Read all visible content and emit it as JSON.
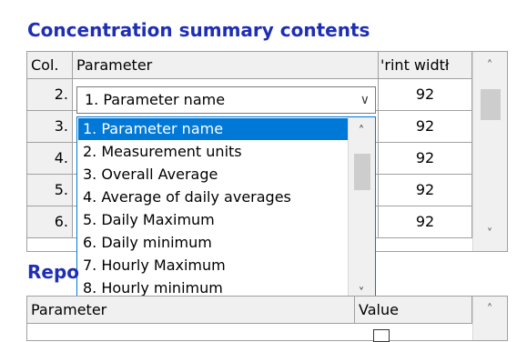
{
  "summary_heading": "Concentration summary contents",
  "grid": {
    "col_header": "Col.",
    "param_header": "Parameter",
    "width_header": "'rint widtł",
    "rows": [
      {
        "col": "2.",
        "width": "92"
      },
      {
        "col": "3.",
        "width": "92"
      },
      {
        "col": "4.",
        "width": "92"
      },
      {
        "col": "5.",
        "width": "92"
      },
      {
        "col": "6.",
        "width": "92"
      }
    ]
  },
  "combo": {
    "selected": "1. Parameter name",
    "options": [
      "1. Parameter name",
      "2. Measurement units",
      "3. Overall Average",
      "4. Average of daily averages",
      "5. Daily Maximum",
      "6. Daily minimum",
      "7. Hourly Maximum",
      "8. Hourly minimum"
    ]
  },
  "report_heading": "Repo",
  "grid2": {
    "param_header": "Parameter",
    "value_header": "Value"
  },
  "colors": {
    "heading": "#1e2fb3",
    "selection": "#0078d7",
    "header_bg": "#f0f0f0"
  },
  "icons": {
    "scroll_up": "chevron-up-icon",
    "scroll_down": "chevron-down-icon",
    "combo_arrow": "chevron-down-icon"
  }
}
